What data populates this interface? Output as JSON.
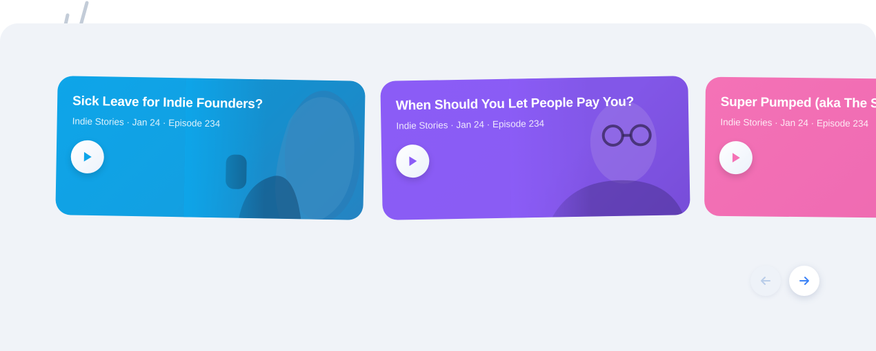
{
  "episodes": [
    {
      "title": "Sick Leave for Indie Founders?",
      "meta": "Indie Stories · Jan 24 · Episode 234",
      "color": "#0ea5e9"
    },
    {
      "title": "When Should You Let People Pay You?",
      "meta": "Indie Stories · Jan 24 · Episode 234",
      "color": "#8b5cf6"
    },
    {
      "title": "Super Pumped (aka The Sa",
      "meta": "Indie Stories · Jan 24 · Episode 234",
      "color": "#f472b6"
    }
  ],
  "icons": {
    "play": "play-icon",
    "previous": "arrow-left-icon",
    "next": "arrow-right-icon"
  },
  "colors": {
    "panel_background": "#f0f3f8",
    "accent": "#3b82f6",
    "disabled": "#b9cde9"
  }
}
